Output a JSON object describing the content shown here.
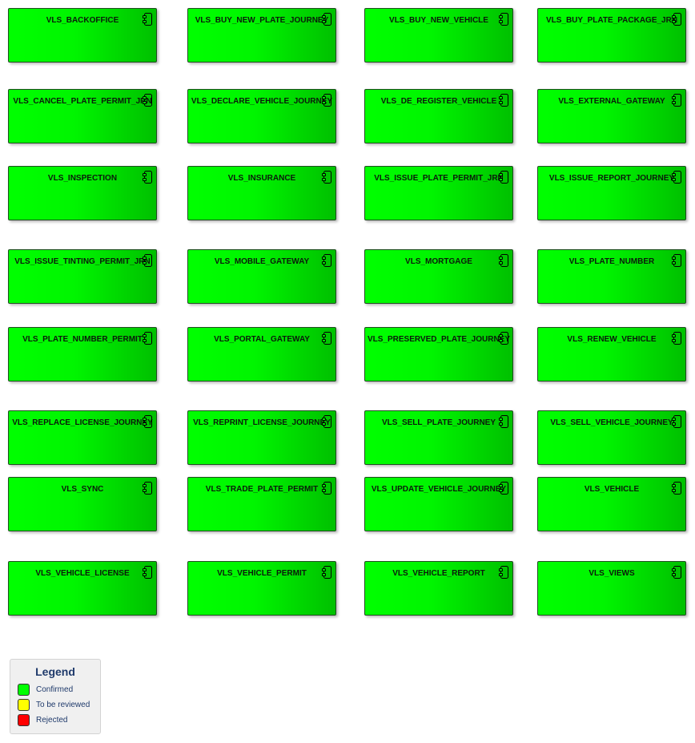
{
  "diagram": {
    "components": [
      "VLS_BACKOFFICE",
      "VLS_BUY_NEW_PLATE_JOURNEY",
      "VLS_BUY_NEW_VEHICLE",
      "VLS_BUY_PLATE_PACKAGE_JRN",
      "VLS_CANCEL_PLATE_PERMIT_JRN",
      "VLS_DECLARE_VEHICLE_JOURNEY",
      "VLS_DE_REGISTER_VEHICLE",
      "VLS_EXTERNAL_GATEWAY",
      "VLS_INSPECTION",
      "VLS_INSURANCE",
      "VLS_ISSUE_PLATE_PERMIT_JRN",
      "VLS_ISSUE_REPORT_JOURNEY",
      "VLS_ISSUE_TINTING_PERMIT_JRN",
      "VLS_MOBILE_GATEWAY",
      "VLS_MORTGAGE",
      "VLS_PLATE_NUMBER",
      "VLS_PLATE_NUMBER_PERMIT",
      "VLS_PORTAL_GATEWAY",
      "VLS_PRESERVED_PLATE_JOURNEY",
      "VLS_RENEW_VEHICLE",
      "VLS_REPLACE_LICENSE_JOURNEY",
      "VLS_REPRINT_LICENSE_JOURNEY",
      "VLS_SELL_PLATE_JOURNEY",
      "VLS_SELL_VEHICLE_JOURNEY",
      "VLS_SYNC",
      "VLS_TRADE_PLATE_PERMIT",
      "VLS_UPDATE_VEHICLE_JOURNEY",
      "VLS_VEHICLE",
      "VLS_VEHICLE_LICENSE",
      "VLS_VEHICLE_PERMIT",
      "VLS_VEHICLE_REPORT",
      "VLS_VIEWS"
    ],
    "component_status": "Confirmed",
    "component_icon": "uml-component-icon"
  },
  "legend": {
    "title": "Legend",
    "items": [
      {
        "label": "Confirmed",
        "color": "#00ff00"
      },
      {
        "label": "To be reviewed",
        "color": "#ffff00"
      },
      {
        "label": "Rejected",
        "color": "#ff0000"
      }
    ]
  }
}
